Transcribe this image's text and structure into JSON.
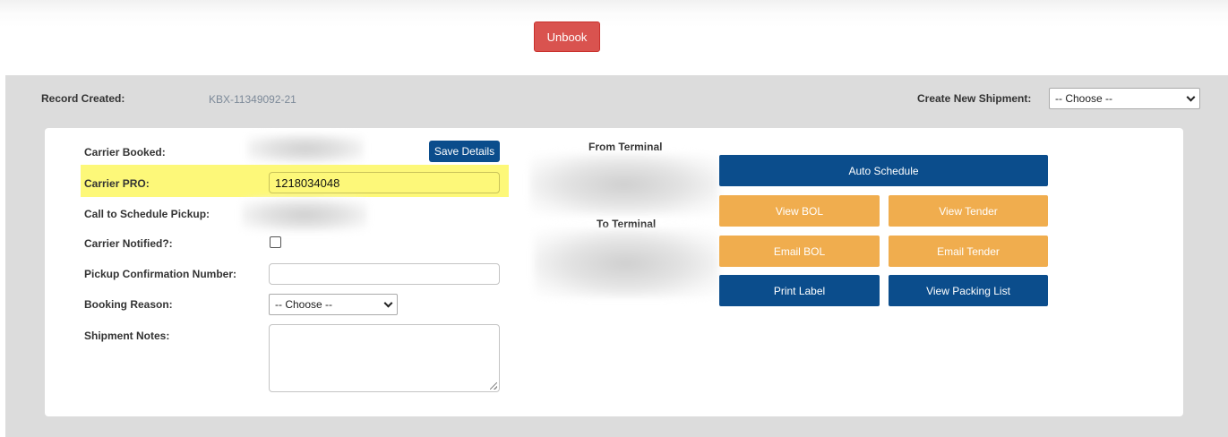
{
  "header": {
    "unbook_label": "Unbook"
  },
  "record": {
    "label": "Record Created:",
    "value": "KBX-11349092-21"
  },
  "create_shipment": {
    "label": "Create New Shipment:",
    "selected": "-- Choose --"
  },
  "form": {
    "carrier_booked_label": "Carrier Booked:",
    "save_details_label": "Save Details",
    "carrier_pro_label": "Carrier PRO:",
    "carrier_pro_value": "1218034048",
    "call_schedule_label": "Call to Schedule Pickup:",
    "carrier_notified_label": "Carrier Notified?:",
    "carrier_notified_checked": false,
    "pickup_confirmation_label": "Pickup Confirmation Number:",
    "pickup_confirmation_value": "",
    "booking_reason_label": "Booking Reason:",
    "booking_reason_selected": "-- Choose --",
    "shipment_notes_label": "Shipment Notes:",
    "shipment_notes_value": ""
  },
  "terminals": {
    "from_label": "From Terminal",
    "to_label": "To Terminal"
  },
  "actions": {
    "auto_schedule": "Auto Schedule",
    "view_bol": "View BOL",
    "view_tender": "View Tender",
    "email_bol": "Email BOL",
    "email_tender": "Email Tender",
    "print_label": "Print Label",
    "view_packing_list": "View Packing List"
  },
  "colors": {
    "primary_blue": "#0b4d8c",
    "action_orange": "#f0ad4e",
    "danger_red": "#d9534f",
    "highlight_yellow": "#fdf879"
  }
}
